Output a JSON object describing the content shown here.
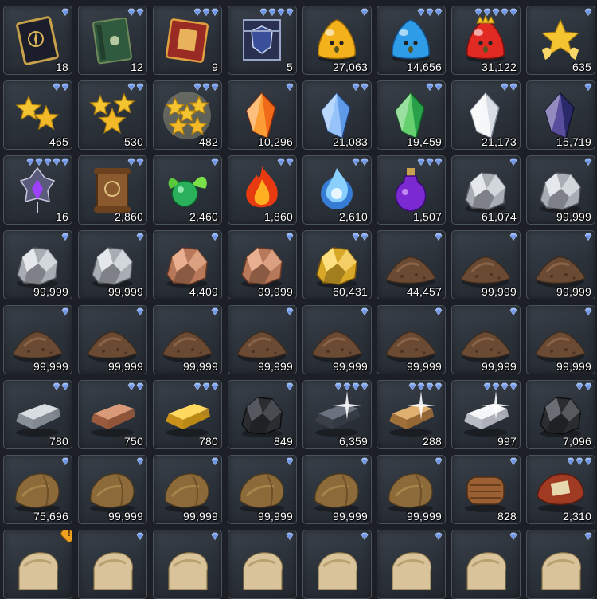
{
  "inventory": {
    "items": [
      {
        "icon": "tome-black-gold-icon",
        "quantity": "18",
        "gems": 1
      },
      {
        "icon": "book-green-icon",
        "quantity": "12",
        "gems": 2
      },
      {
        "icon": "book-red-icon",
        "quantity": "9",
        "gems": 3
      },
      {
        "icon": "banner-armor-icon",
        "quantity": "5",
        "gems": 4
      },
      {
        "icon": "slime-gold-icon",
        "quantity": "27,063",
        "gems": 1
      },
      {
        "icon": "slime-blue-icon",
        "quantity": "14,656",
        "gems": 3
      },
      {
        "icon": "slime-red-crown-icon",
        "quantity": "31,122",
        "gems": 5
      },
      {
        "icon": "star-gold-icon",
        "quantity": "635",
        "gems": 1
      },
      {
        "icon": "stars-double-icon",
        "quantity": "465",
        "gems": 2
      },
      {
        "icon": "stars-triple-icon",
        "quantity": "530",
        "gems": 2
      },
      {
        "icon": "stars-glowing-icon",
        "quantity": "482",
        "gems": 3
      },
      {
        "icon": "crystal-orange-icon",
        "quantity": "10,296",
        "gems": 1
      },
      {
        "icon": "crystal-blue-icon",
        "quantity": "21,083",
        "gems": 2
      },
      {
        "icon": "crystal-green-icon",
        "quantity": "19,459",
        "gems": 2
      },
      {
        "icon": "crystal-white-icon",
        "quantity": "21,173",
        "gems": 2
      },
      {
        "icon": "crystal-dark-purple-icon",
        "quantity": "15,719",
        "gems": 1
      },
      {
        "icon": "amulet-purple-icon",
        "quantity": "16",
        "gems": 5
      },
      {
        "icon": "scroll-seal-icon",
        "quantity": "2,860",
        "gems": 2
      },
      {
        "icon": "orb-green-leaf-icon",
        "quantity": "2,460",
        "gems": 1
      },
      {
        "icon": "flame-crystal-red-icon",
        "quantity": "1,860",
        "gems": 2
      },
      {
        "icon": "flame-orb-blue-icon",
        "quantity": "2,610",
        "gems": 2
      },
      {
        "icon": "potion-purple-icon",
        "quantity": "1,507",
        "gems": 3
      },
      {
        "icon": "ore-silver-icon",
        "quantity": "61,074",
        "gems": 1
      },
      {
        "icon": "ore-silver-icon",
        "quantity": "99,999",
        "gems": 1
      },
      {
        "icon": "ore-silver-icon",
        "quantity": "99,999",
        "gems": 1
      },
      {
        "icon": "ore-silver-icon",
        "quantity": "99,999",
        "gems": 1
      },
      {
        "icon": "ore-copper-icon",
        "quantity": "4,409",
        "gems": 1
      },
      {
        "icon": "ore-copper-icon",
        "quantity": "99,999",
        "gems": 1
      },
      {
        "icon": "ore-gold-icon",
        "quantity": "60,431",
        "gems": 2
      },
      {
        "icon": "dirt-pile-icon",
        "quantity": "44,457",
        "gems": 1
      },
      {
        "icon": "dirt-pile-icon",
        "quantity": "99,999",
        "gems": 1
      },
      {
        "icon": "dirt-pile-icon",
        "quantity": "99,999",
        "gems": 1
      },
      {
        "icon": "dirt-pile-icon",
        "quantity": "99,999",
        "gems": 1
      },
      {
        "icon": "dirt-pile-icon",
        "quantity": "99,999",
        "gems": 1
      },
      {
        "icon": "dirt-pile-icon",
        "quantity": "99,999",
        "gems": 1
      },
      {
        "icon": "dirt-pile-icon",
        "quantity": "99,999",
        "gems": 1
      },
      {
        "icon": "dirt-pile-icon",
        "quantity": "99,999",
        "gems": 1
      },
      {
        "icon": "dirt-pile-icon",
        "quantity": "99,999",
        "gems": 1
      },
      {
        "icon": "dirt-pile-icon",
        "quantity": "99,999",
        "gems": 1
      },
      {
        "icon": "dirt-pile-icon",
        "quantity": "99,999",
        "gems": 1
      },
      {
        "icon": "ingot-silver-icon",
        "quantity": "780",
        "gems": 2
      },
      {
        "icon": "ingot-copper-icon",
        "quantity": "750",
        "gems": 2
      },
      {
        "icon": "ingot-gold-icon",
        "quantity": "780",
        "gems": 3
      },
      {
        "icon": "coal-lump-icon",
        "quantity": "849",
        "gems": 1
      },
      {
        "icon": "ingot-dark-shining-icon",
        "quantity": "6,359",
        "gems": 4
      },
      {
        "icon": "ingot-bronze-shining-icon",
        "quantity": "288",
        "gems": 4
      },
      {
        "icon": "ingot-platinum-shining-icon",
        "quantity": "997",
        "gems": 4
      },
      {
        "icon": "ore-black-icon",
        "quantity": "7,096",
        "gems": 2
      },
      {
        "icon": "leather-hide-icon",
        "quantity": "75,696",
        "gems": 1
      },
      {
        "icon": "leather-hide-icon",
        "quantity": "99,999",
        "gems": 1
      },
      {
        "icon": "leather-hide-icon",
        "quantity": "99,999",
        "gems": 1
      },
      {
        "icon": "leather-hide-icon",
        "quantity": "99,999",
        "gems": 1
      },
      {
        "icon": "leather-hide-icon",
        "quantity": "99,999",
        "gems": 1
      },
      {
        "icon": "leather-hide-icon",
        "quantity": "99,999",
        "gems": 1
      },
      {
        "icon": "leather-roll-icon",
        "quantity": "828",
        "gems": 1
      },
      {
        "icon": "leather-red-icon",
        "quantity": "2,310",
        "gems": 3
      },
      {
        "icon": "parchment-roll-icon",
        "quantity": "",
        "gems": 1,
        "alert": "!"
      },
      {
        "icon": "parchment-roll-icon",
        "quantity": "",
        "gems": 1
      },
      {
        "icon": "parchment-roll-icon",
        "quantity": "",
        "gems": 1
      },
      {
        "icon": "parchment-roll-icon",
        "quantity": "",
        "gems": 1
      },
      {
        "icon": "parchment-roll-icon",
        "quantity": "",
        "gems": 1
      },
      {
        "icon": "parchment-roll-icon",
        "quantity": "",
        "gems": 1
      },
      {
        "icon": "parchment-roll-icon",
        "quantity": "",
        "gems": 1
      },
      {
        "icon": "parchment-roll-icon",
        "quantity": "",
        "gems": 1
      }
    ]
  },
  "colors": {
    "gem": "#8fb4ff",
    "alert": "#f0a020"
  }
}
